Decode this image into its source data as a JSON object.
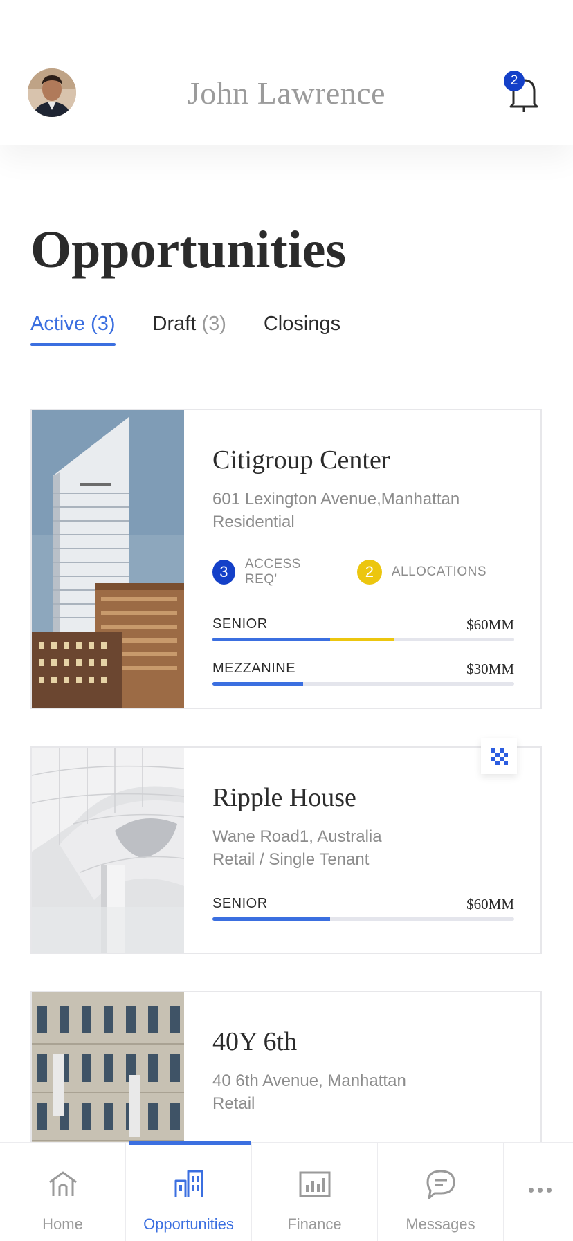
{
  "header": {
    "user_name": "John Lawrence",
    "notification_count": "2"
  },
  "page": {
    "title": "Opportunities"
  },
  "tabs": [
    {
      "label": "Active",
      "count": "(3)",
      "active": true
    },
    {
      "label": "Draft",
      "count": "(3)",
      "active": false
    },
    {
      "label": "Closings",
      "count": "",
      "active": false
    }
  ],
  "opportunities": [
    {
      "name": "Citigroup Center",
      "address": "601 Lexington Avenue,Manhattan",
      "type": "Residential",
      "badges": [
        {
          "count": "3",
          "label": "ACCESS REQ'",
          "color": "#1440c8"
        },
        {
          "count": "2",
          "label": "ALLOCATIONS",
          "color": "#ecc60f"
        }
      ],
      "tranches": [
        {
          "name": "SENIOR",
          "amount": "$60MM",
          "progress_blue": 0.39,
          "progress_yellow": 0.21
        },
        {
          "name": "MEZZANINE",
          "amount": "$30MM",
          "progress_blue": 0.3,
          "progress_yellow": 0
        }
      ]
    },
    {
      "name": "Ripple House",
      "address": "Wane Road1, Australia",
      "type": "Retail / Single Tenant",
      "pinned": true,
      "tranches": [
        {
          "name": "SENIOR",
          "amount": "$60MM",
          "progress_blue": 0.39,
          "progress_yellow": 0
        }
      ]
    },
    {
      "name": "40Y 6th",
      "address": "40 6th Avenue, Manhattan",
      "type": "Retail"
    }
  ],
  "bottom_nav": [
    {
      "label": "Home",
      "icon": "home-icon",
      "active": false
    },
    {
      "label": "Opportunities",
      "icon": "buildings-icon",
      "active": true
    },
    {
      "label": "Finance",
      "icon": "bar-chart-icon",
      "active": false
    },
    {
      "label": "Messages",
      "icon": "chat-icon",
      "active": false
    }
  ],
  "colors": {
    "accent": "#3b6fe0",
    "badge_blue": "#1440c8",
    "badge_yellow": "#ecc60f"
  }
}
